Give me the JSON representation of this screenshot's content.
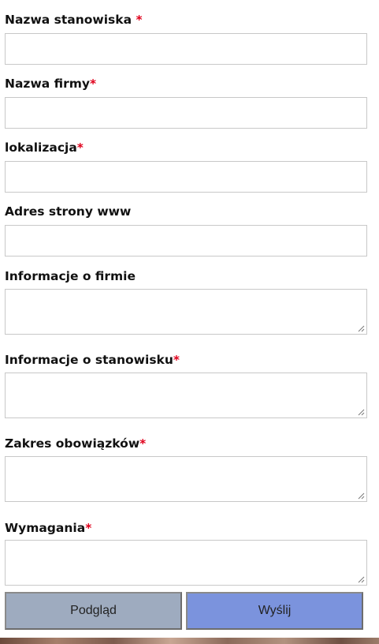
{
  "form": {
    "fields": [
      {
        "label": "Nazwa stanowiska",
        "required_mark": " *",
        "type": "input",
        "value": ""
      },
      {
        "label": "Nazwa firmy",
        "required_mark": "*",
        "type": "input",
        "value": ""
      },
      {
        "label": "lokalizacja",
        "required_mark": "*",
        "type": "input",
        "value": ""
      },
      {
        "label": "Adres strony www",
        "required_mark": "",
        "type": "input",
        "value": ""
      },
      {
        "label": "Informacje o firmie",
        "required_mark": "",
        "type": "textarea",
        "value": ""
      },
      {
        "label": "Informacje o stanowisku",
        "required_mark": "*",
        "type": "textarea",
        "value": ""
      },
      {
        "label": "Zakres obowiązków",
        "required_mark": "*",
        "type": "textarea",
        "value": ""
      },
      {
        "label": "Wymagania",
        "required_mark": "*",
        "type": "textarea",
        "value": ""
      }
    ],
    "buttons": {
      "preview_label": "Podgląd",
      "submit_label": "Wyślij"
    }
  },
  "colors": {
    "required": "#e0001b",
    "preview_button": "#9eabbf",
    "submit_button": "#7b93dd",
    "input_border": "#c8c8c8"
  }
}
